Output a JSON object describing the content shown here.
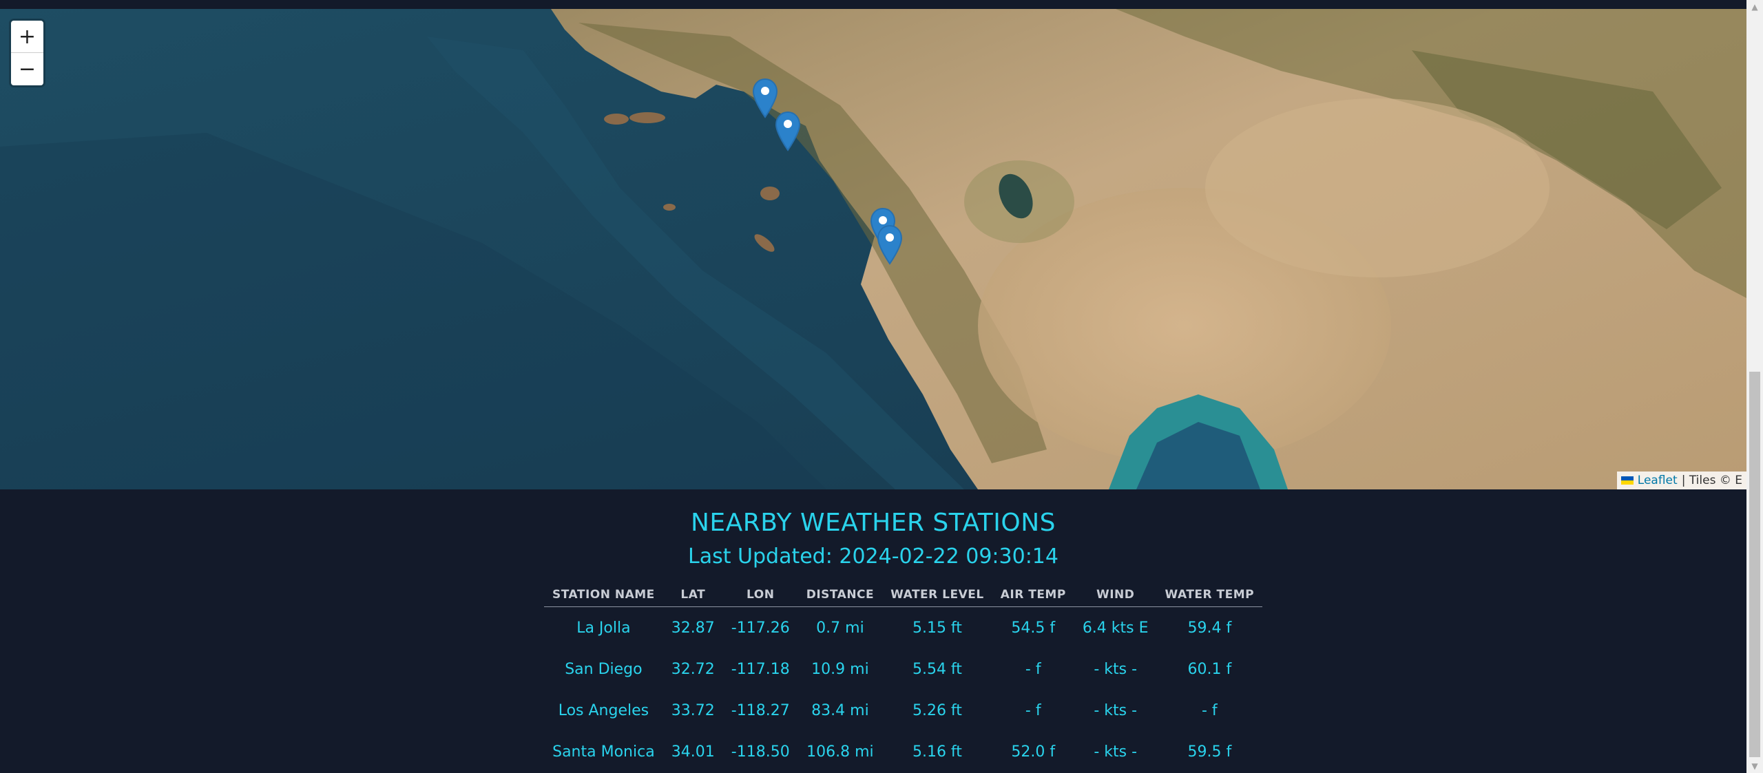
{
  "map": {
    "zoom_in_label": "+",
    "zoom_out_label": "−",
    "attribution_link": "Leaflet",
    "attribution_text": "| Tiles © E",
    "marker_color": "#2b82cb"
  },
  "header": {
    "title": "NEARBY WEATHER STATIONS",
    "last_updated": "Last Updated: 2024-02-22 09:30:14"
  },
  "table": {
    "columns": [
      "STATION NAME",
      "LAT",
      "LON",
      "DISTANCE",
      "WATER LEVEL",
      "AIR TEMP",
      "WIND",
      "WATER TEMP"
    ],
    "rows": [
      [
        "La Jolla",
        "32.87",
        "-117.26",
        "0.7 mi",
        "5.15 ft",
        "54.5 f",
        "6.4 kts E",
        "59.4 f"
      ],
      [
        "San Diego",
        "32.72",
        "-117.18",
        "10.9 mi",
        "5.54 ft",
        "- f",
        "- kts -",
        "60.1 f"
      ],
      [
        "Los Angeles",
        "33.72",
        "-118.27",
        "83.4 mi",
        "5.26 ft",
        "- f",
        "- kts -",
        "- f"
      ],
      [
        "Santa Monica",
        "34.01",
        "-118.50",
        "106.8 mi",
        "5.16 ft",
        "52.0 f",
        "- kts -",
        "59.5 f"
      ]
    ]
  },
  "colors": {
    "accent": "#2ad3ec",
    "background": "#131a2a",
    "header_text": "#c9cdd5"
  }
}
